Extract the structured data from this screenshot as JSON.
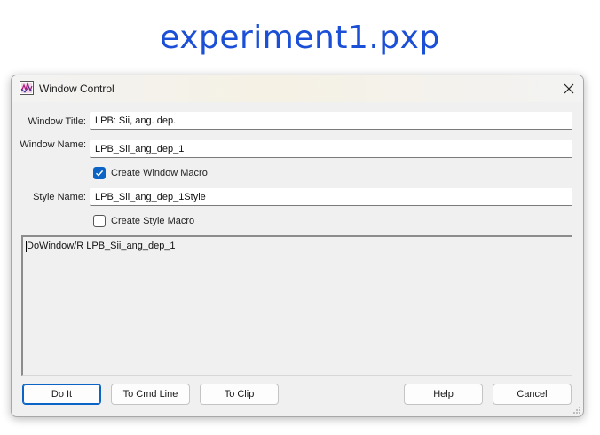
{
  "background": {
    "title": "experiment1.pxp"
  },
  "dialog": {
    "title": "Window Control",
    "fields": {
      "window_title": {
        "label": "Window Title:",
        "value": "LPB: Sii, ang. dep."
      },
      "window_name": {
        "label": "Window Name:",
        "value": "LPB_Sii_ang_dep_1"
      },
      "style_name": {
        "label": "Style Name:",
        "value": "LPB_Sii_ang_dep_1Style"
      }
    },
    "checkboxes": {
      "create_window_macro": {
        "label": "Create Window Macro",
        "checked": true
      },
      "create_style_macro": {
        "label": "Create Style Macro",
        "checked": false
      }
    },
    "macro_text": "DoWindow/R LPB_Sii_ang_dep_1",
    "buttons": {
      "do_it": "Do It",
      "to_cmd_line": "To Cmd Line",
      "to_clip": "To Clip",
      "help": "Help",
      "cancel": "Cancel"
    }
  },
  "icons": {
    "app": "igor-graph-icon",
    "close": "close-icon",
    "check": "checkmark-icon"
  },
  "colors": {
    "accent": "#0b63c5",
    "title_blue": "#1a4fd6"
  }
}
